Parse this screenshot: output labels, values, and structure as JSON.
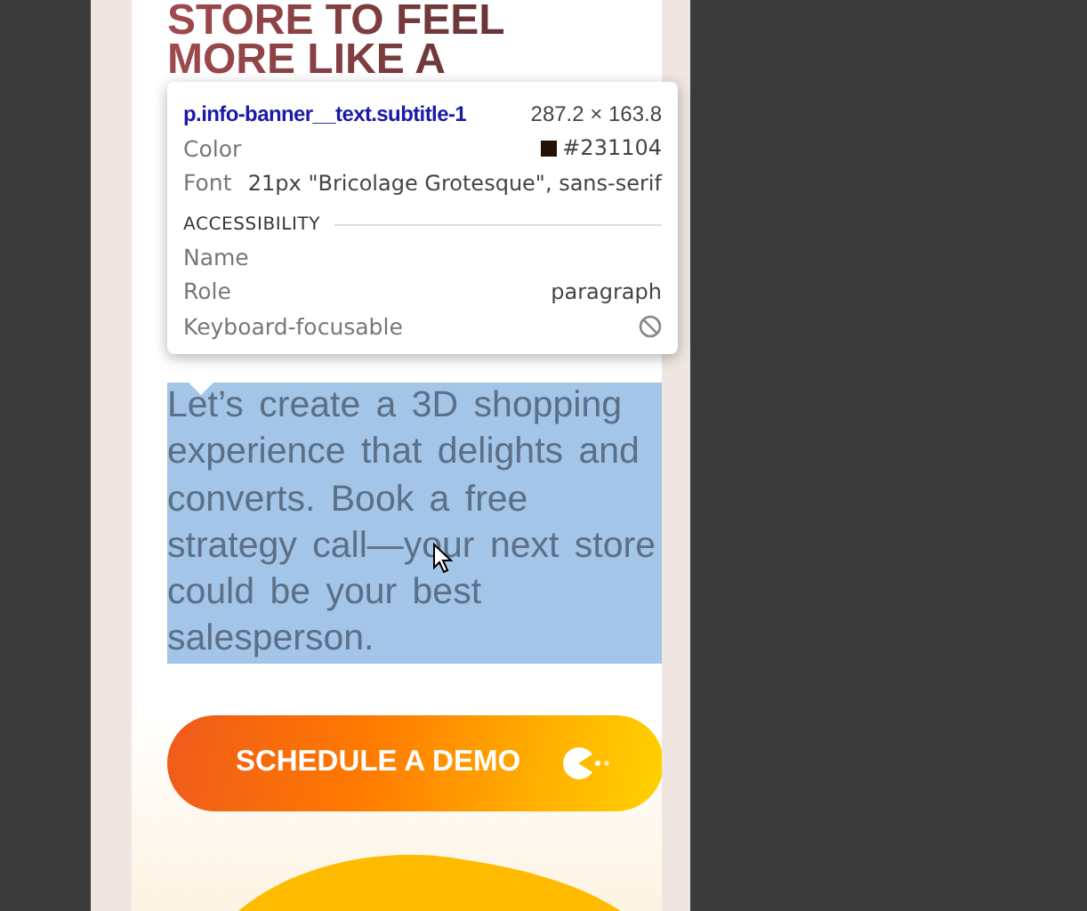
{
  "heading_lines": [
    "STORE TO FEEL",
    "MORE LIKE A"
  ],
  "paragraph": {
    "text": "Let’s create a 3D shopping experience that delights and converts. Book a free strategy call—your next store could be your best salesperson.",
    "selected": true
  },
  "button": {
    "label": "SCHEDULE A DEMO"
  },
  "inspector_tooltip": {
    "selector": "p.info-banner__text.subtitle-1",
    "size": "287.2 × 163.8",
    "rows": [
      {
        "label": "Color",
        "value": "#231104",
        "color": "#231104"
      },
      {
        "label": "Font",
        "value": "21px \"Bricolage Grotesque\", sans-serif"
      }
    ],
    "section_title": "ACCESSIBILITY",
    "accessibility_rows": [
      {
        "label": "Name"
      },
      {
        "label": "Role",
        "value": "paragraph"
      },
      {
        "label": "Keyboard-focusable",
        "focusable": false
      }
    ]
  }
}
